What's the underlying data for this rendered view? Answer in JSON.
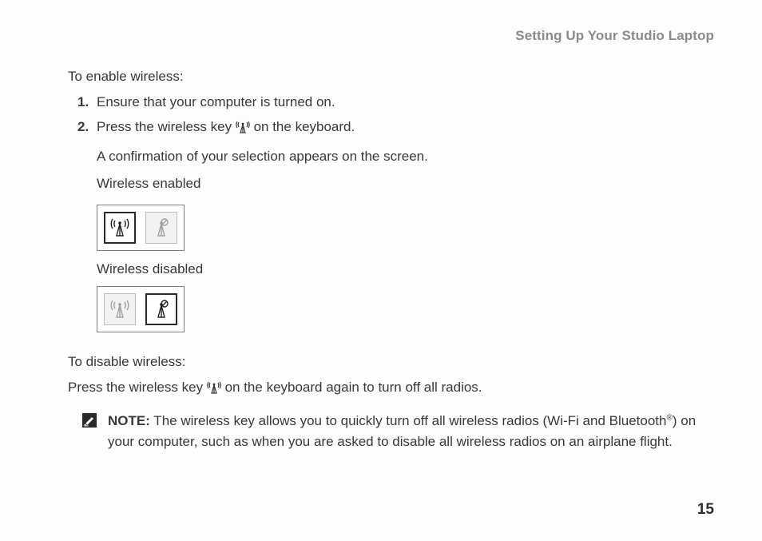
{
  "header": "Setting Up Your Studio Laptop",
  "enable": {
    "intro": "To enable wireless:",
    "step1_num": "1.",
    "step1": "Ensure that your computer is turned on.",
    "step2_num": "2.",
    "step2_before": "Press the wireless key ",
    "step2_after": " on the keyboard.",
    "confirm": "A confirmation of your selection appears on the screen.",
    "enabled_label": "Wireless enabled",
    "disabled_label": "Wireless disabled"
  },
  "disable": {
    "intro": "To disable wireless:",
    "line_before": "Press the wireless key ",
    "line_after": " on the keyboard again to turn off all radios."
  },
  "note": {
    "label": "NOTE:",
    "text_a": " The wireless key allows you to quickly turn off all wireless radios (Wi-Fi and Bluetooth",
    "reg": "®",
    "text_b": ") on your computer, such as when you are asked to disable all wireless radios on an airplane flight."
  },
  "page_number": "15"
}
